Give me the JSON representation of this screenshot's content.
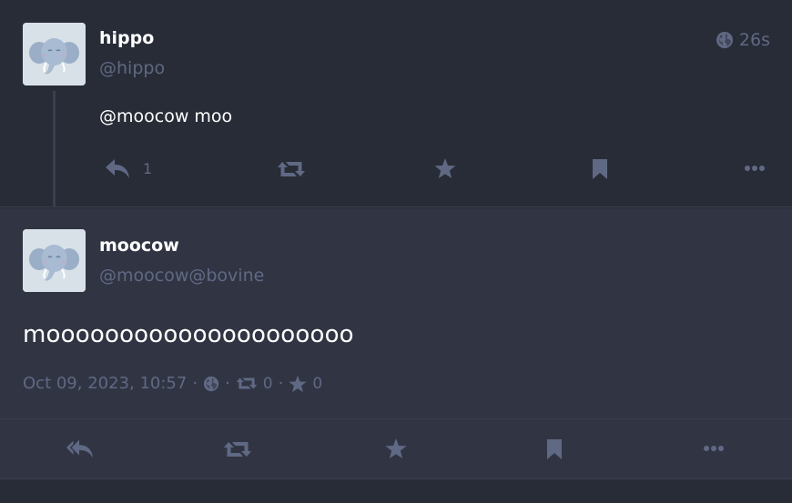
{
  "reply_status": {
    "display_name": "hippo",
    "acct": "@hippo",
    "relative_time": "26s",
    "visibility_icon": "globe-icon",
    "content": "@moocow moo",
    "reply_count": "1",
    "actions": [
      "reply-icon",
      "boost-icon",
      "favourite-icon",
      "bookmark-icon",
      "more-icon"
    ]
  },
  "detailed_status": {
    "display_name": "moocow",
    "acct": "@moocow@bovine",
    "content": "mooooooooooooooooooooo",
    "timestamp": "Oct 09, 2023, 10:57",
    "separator": "·",
    "boost_count": "0",
    "favourite_count": "0",
    "actions": [
      "reply-all-icon",
      "boost-icon",
      "favourite-icon",
      "bookmark-icon",
      "more-icon"
    ]
  },
  "colors": {
    "background": "#282c37",
    "detailed_background": "#313543",
    "muted_text": "#606984",
    "primary_text": "#ffffff",
    "divider": "#393f4f"
  }
}
